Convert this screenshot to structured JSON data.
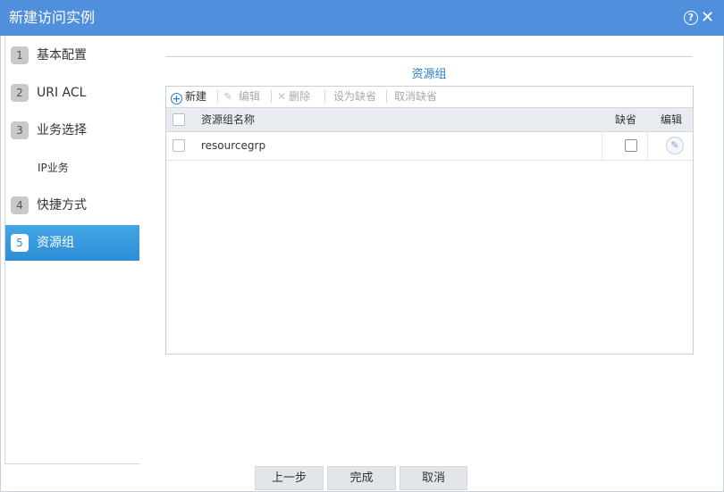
{
  "window": {
    "title": "新建访问实例",
    "help_icon": "help-circle-icon",
    "close_icon": "close-icon"
  },
  "sidebar": {
    "items": [
      {
        "num": "1",
        "label": "基本配置"
      },
      {
        "num": "2",
        "label": "URI ACL"
      },
      {
        "num": "3",
        "label": "业务选择"
      },
      {
        "sub": "IP业务"
      },
      {
        "num": "4",
        "label": "快捷方式"
      },
      {
        "num": "5",
        "label": "资源组",
        "active": true
      }
    ]
  },
  "main": {
    "section_title": "资源组",
    "toolbar": {
      "new": "新建",
      "edit": "编辑",
      "delete": "删除",
      "set_default": "设为缺省",
      "cancel_default": "取消缺省"
    },
    "table": {
      "columns": [
        "资源组名称",
        "缺省",
        "编辑"
      ],
      "rows": [
        {
          "name": "resourcegrp",
          "default": false
        }
      ]
    }
  },
  "footer": {
    "prev": "上一步",
    "finish": "完成",
    "cancel": "取消"
  },
  "colors": {
    "titlebar": "#4f8fdc",
    "active_nav": "#2c8dd6",
    "accent_text": "#2c7cc8"
  }
}
